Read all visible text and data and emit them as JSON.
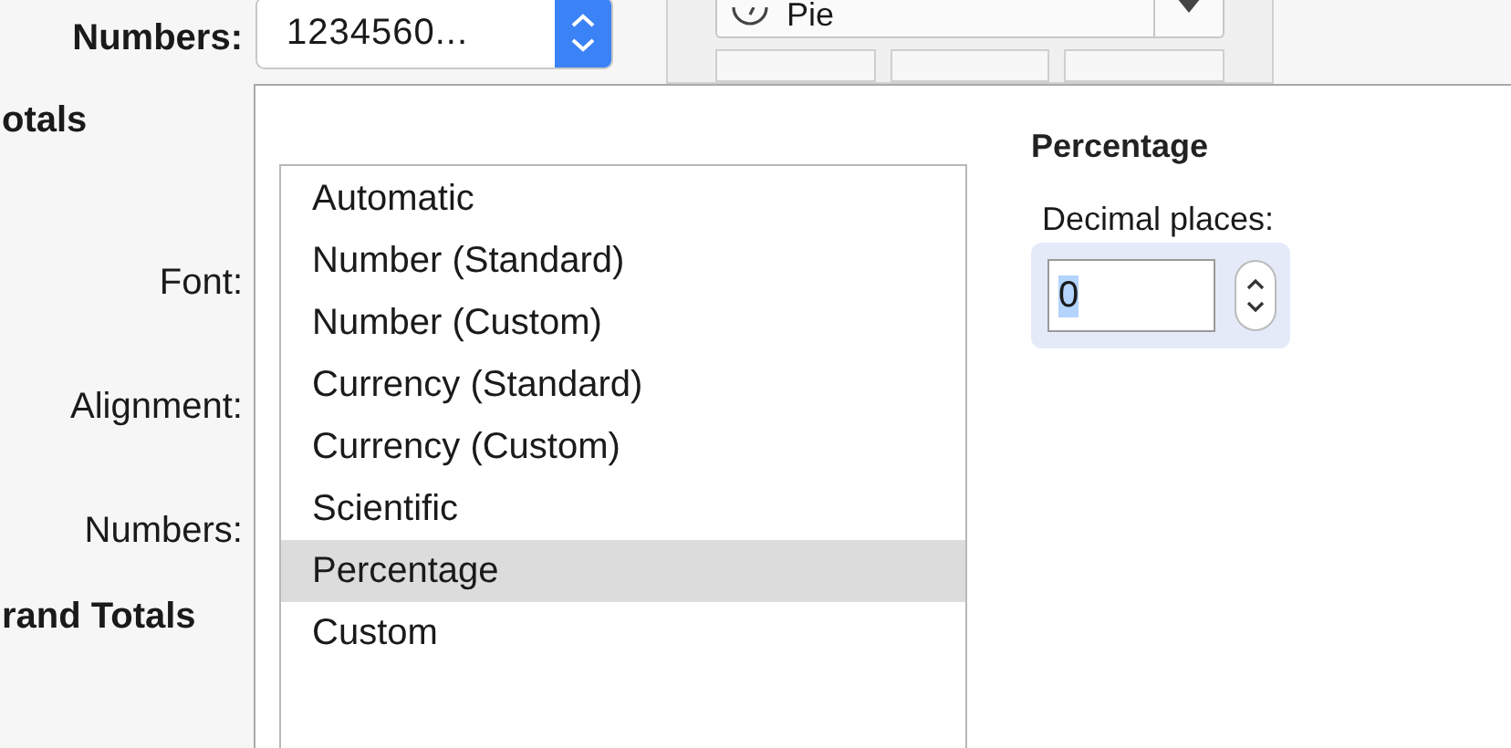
{
  "top": {
    "numbers_label": "Numbers:",
    "numbers_value": "1234560...",
    "chart_type": "Pie"
  },
  "sidebar": [
    {
      "text": "otals",
      "kind": "heading"
    },
    {
      "text": "Font:",
      "kind": "field"
    },
    {
      "text": "Alignment:",
      "kind": "field"
    },
    {
      "text": "Numbers:",
      "kind": "field"
    },
    {
      "text": "rand Totals",
      "kind": "heading"
    }
  ],
  "format_list": [
    {
      "label": "Automatic",
      "selected": false
    },
    {
      "label": "Number (Standard)",
      "selected": false
    },
    {
      "label": "Number (Custom)",
      "selected": false
    },
    {
      "label": "Currency (Standard)",
      "selected": false
    },
    {
      "label": "Currency (Custom)",
      "selected": false
    },
    {
      "label": "Scientific",
      "selected": false
    },
    {
      "label": "Percentage",
      "selected": true
    },
    {
      "label": "Custom",
      "selected": false
    }
  ],
  "detail": {
    "title": "Percentage",
    "decimal_label": "Decimal places:",
    "decimal_value": "0"
  }
}
